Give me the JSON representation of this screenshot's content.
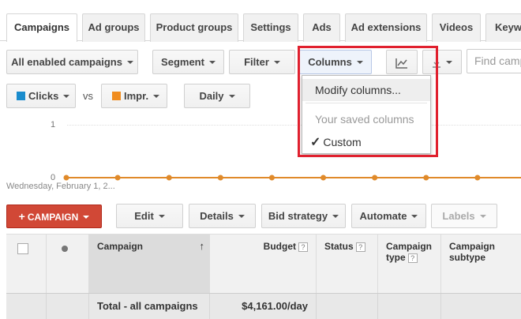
{
  "tabs": [
    "Campaigns",
    "Ad groups",
    "Product groups",
    "Settings",
    "Ads",
    "Ad extensions",
    "Videos",
    "Keywords"
  ],
  "toolbar": {
    "filter_select": "All enabled campaigns",
    "segment": "Segment",
    "filter": "Filter",
    "columns": "Columns",
    "search_placeholder": "Find campaigns"
  },
  "columns_menu": {
    "modify": "Modify columns...",
    "saved_header": "Your saved columns",
    "custom": "Custom",
    "custom_check": "✓"
  },
  "metrics": {
    "metric1": "Clicks",
    "metric1_color": "#1a8ccd",
    "vs": "vs",
    "metric2": "Impr.",
    "metric2_color": "#f08c1e",
    "period": "Daily"
  },
  "chart_data": {
    "type": "line",
    "y_ticks": [
      "1",
      "0"
    ],
    "ylim": [
      0,
      1
    ],
    "x_start_label": "Wednesday, February 1, 2...",
    "series": [
      {
        "values": [
          0,
          0,
          0,
          0,
          0,
          0,
          0,
          0,
          0,
          0
        ],
        "color": "#e08a2a"
      }
    ]
  },
  "actions": {
    "campaign": "CAMPAIGN",
    "edit": "Edit",
    "details": "Details",
    "bid_strategy": "Bid strategy",
    "automate": "Automate",
    "labels": "Labels"
  },
  "table": {
    "headers": {
      "campaign": "Campaign",
      "budget": "Budget",
      "status": "Status",
      "campaign_type": "Campaign type",
      "campaign_subtype": "Campaign subtype"
    },
    "help_glyph": "?",
    "sort_glyph": "↑",
    "total_row": {
      "label": "Total - all campaigns",
      "budget": "$4,161.00/day"
    }
  }
}
